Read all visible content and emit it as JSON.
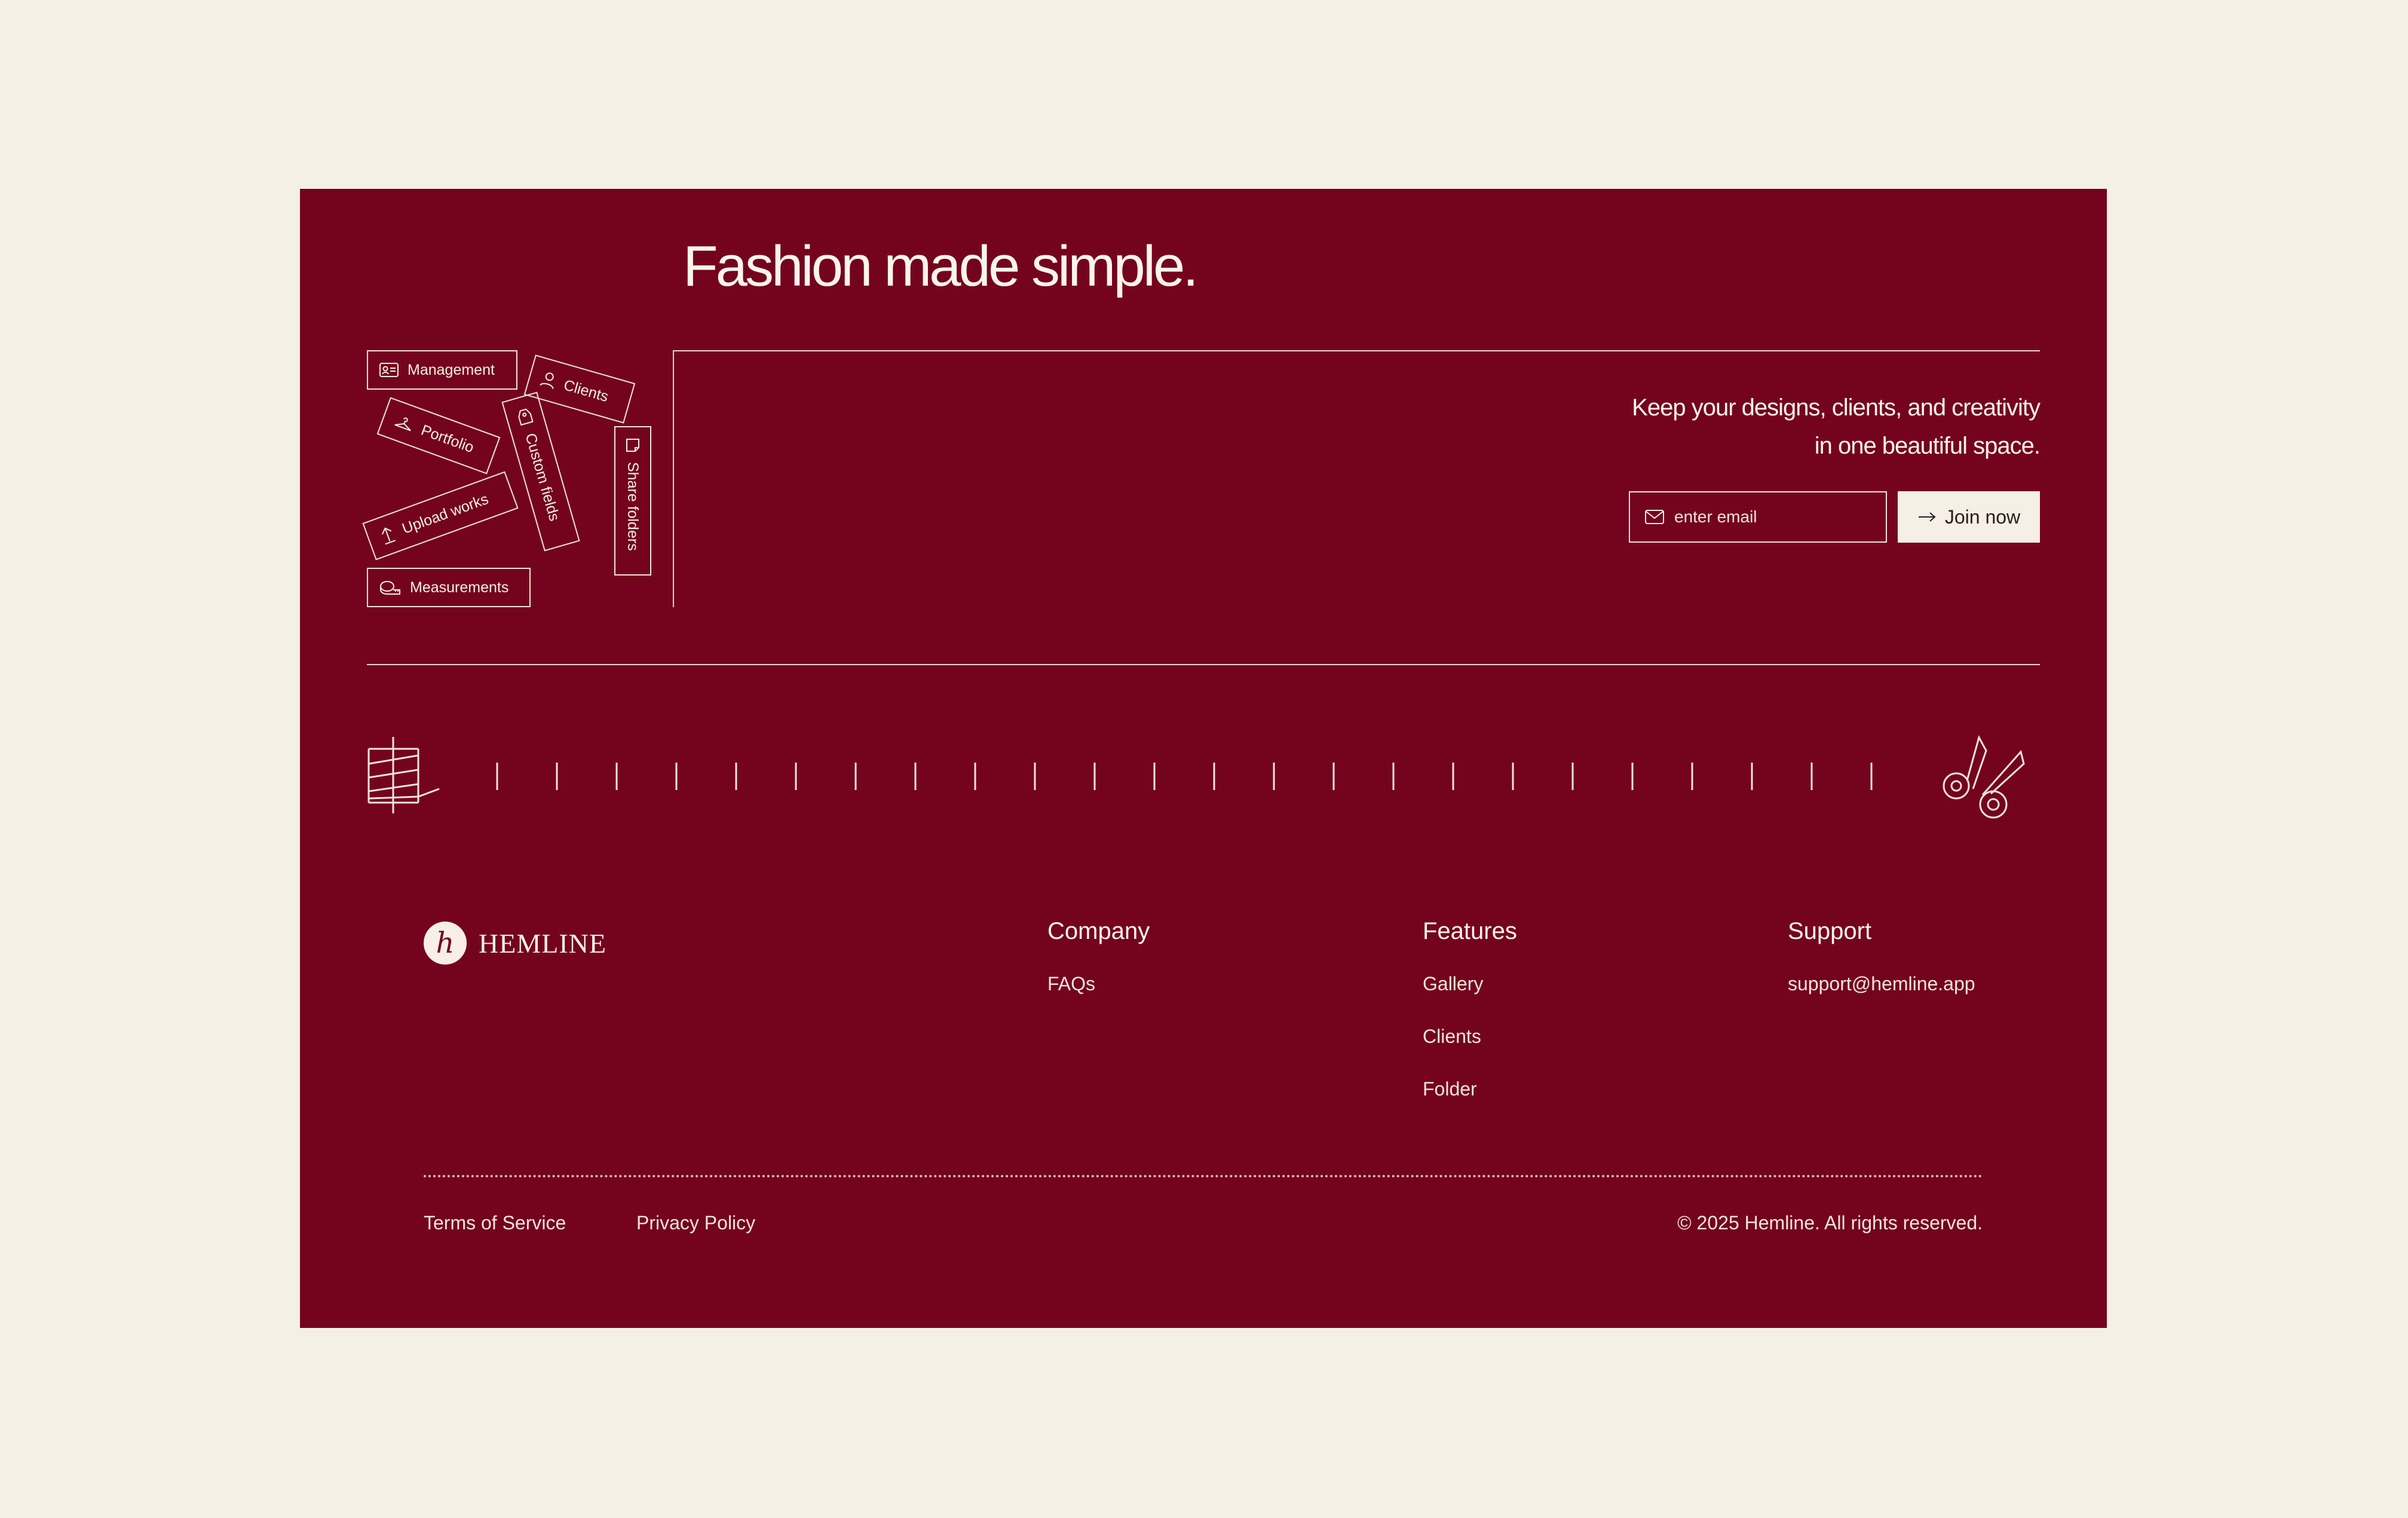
{
  "hero": {
    "headline": "Fashion made simple.",
    "tagline_line1": "Keep your designs, clients, and creativity",
    "tagline_line2": "in one beautiful space."
  },
  "tags": {
    "management": "Management",
    "clients": "Clients",
    "portfolio": "Portfolio",
    "custom_fields": "Custom fields",
    "share_folders": "Share folders",
    "upload_works": "Upload works",
    "measurements": "Measurements"
  },
  "signup": {
    "email_placeholder": "enter email",
    "join_label": "Join now"
  },
  "brand": {
    "logo_mark": "h",
    "name": "HEMLINE"
  },
  "footer": {
    "company": {
      "title": "Company",
      "links": [
        "FAQs"
      ]
    },
    "features": {
      "title": "Features",
      "links": [
        "Gallery",
        "Clients",
        "Folder"
      ]
    },
    "support": {
      "title": "Support",
      "links": [
        "support@hemline.app"
      ]
    },
    "terms": "Terms of Service",
    "privacy": "Privacy Policy",
    "copyright": "© 2025 Hemline. All rights reserved."
  },
  "colors": {
    "background": "#f5f0e6",
    "panel": "#74041e",
    "ink": "#f5efe6"
  }
}
